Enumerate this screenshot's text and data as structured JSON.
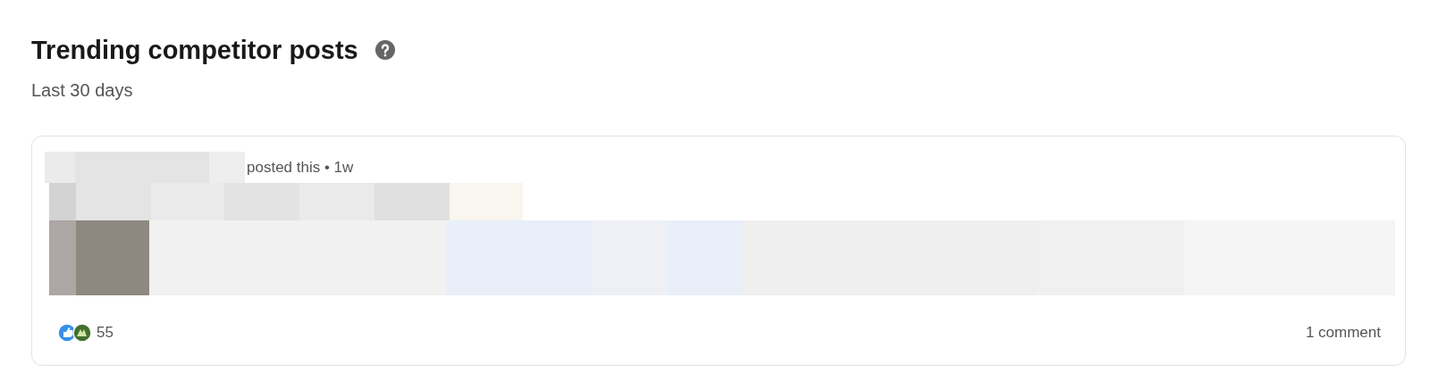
{
  "header": {
    "title": "Trending competitor posts",
    "subtitle": "Last 30 days"
  },
  "post": {
    "byline": "posted this • 1w",
    "reactions_count": "55",
    "comments": "1 comment"
  }
}
